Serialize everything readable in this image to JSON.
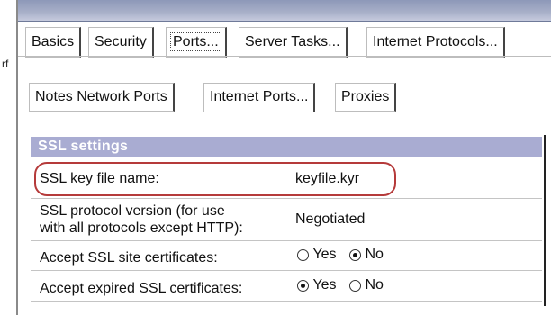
{
  "window": {
    "left_stub_text": "rf"
  },
  "tabs": [
    {
      "label": "Basics",
      "active": false
    },
    {
      "label": "Security",
      "active": false
    },
    {
      "label": "Ports...",
      "active": true
    },
    {
      "label": "Server Tasks...",
      "active": false
    },
    {
      "label": "Internet Protocols...",
      "active": false
    }
  ],
  "subtabs": [
    {
      "label": "Notes Network Ports",
      "active": false
    },
    {
      "label": "Internet Ports...",
      "active": true
    },
    {
      "label": "Proxies",
      "active": false
    }
  ],
  "section": {
    "title": "SSL settings"
  },
  "fields": {
    "key_file": {
      "label": "SSL key file name:",
      "value": "keyfile.kyr"
    },
    "protocol_version": {
      "label_line1": "SSL protocol version (for use",
      "label_line2": "with all protocols except HTTP):",
      "value": "Negotiated"
    },
    "accept_site_certs": {
      "label": "Accept SSL site certificates:",
      "options": [
        "Yes",
        "No"
      ],
      "selected": "No"
    },
    "accept_expired_certs": {
      "label": "Accept expired SSL certificates:",
      "options": [
        "Yes",
        "No"
      ],
      "selected": "Yes"
    }
  },
  "colors": {
    "section_header_bg": "#a9acd2",
    "highlight_border": "#b53a3a"
  }
}
